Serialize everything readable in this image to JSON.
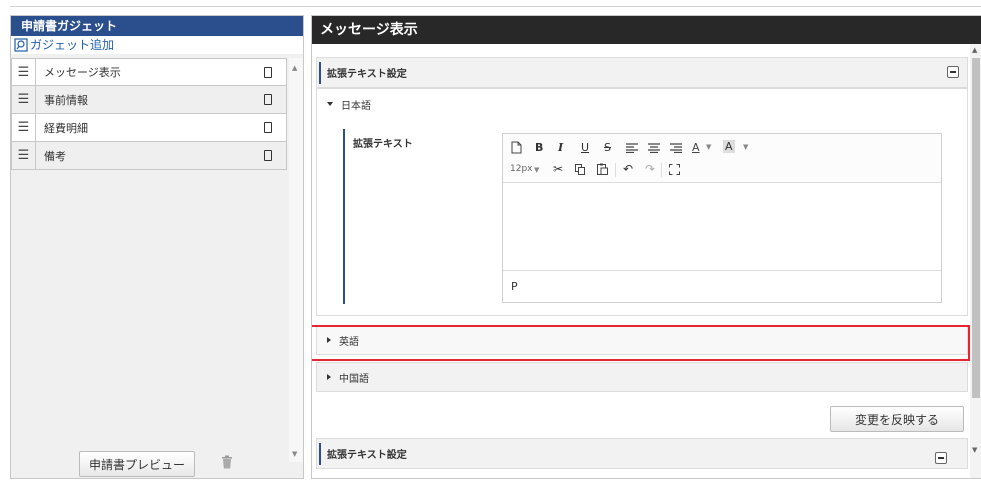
{
  "left_panel": {
    "title": "申請書ガジェット",
    "add_link": "ガジェット追加",
    "items": [
      {
        "label": "メッセージ表示"
      },
      {
        "label": "事前情報"
      },
      {
        "label": "経費明細"
      },
      {
        "label": "備考"
      }
    ],
    "preview_button": "申請書プレビュー"
  },
  "right_panel": {
    "title": "メッセージ表示",
    "section_title": "拡張テキスト設定",
    "section_title_2": "拡張テキスト設定",
    "languages": {
      "japanese": "日本語",
      "english": "英語",
      "chinese": "中国語"
    },
    "field_label": "拡張テキスト",
    "editor": {
      "font_size": "12px",
      "status_path": "P",
      "toolbar": {
        "bold": "B",
        "italic": "I",
        "underline": "U",
        "strike": "S",
        "text_color": "A",
        "bg_color": "A"
      }
    },
    "apply_button": "変更を反映する"
  },
  "colors": {
    "left_header": "#2b4f8c",
    "right_header": "#282828",
    "highlight": "#e5252f",
    "link": "#1f5fa8"
  }
}
